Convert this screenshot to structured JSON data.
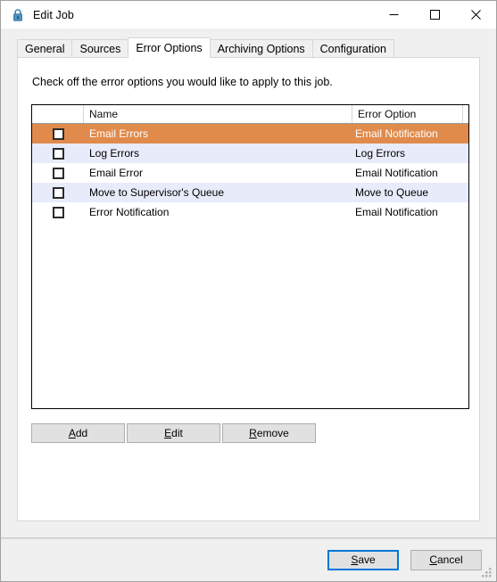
{
  "window": {
    "title": "Edit Job",
    "icon": "padlock-icon",
    "caption_buttons": [
      {
        "name": "minimize",
        "glyph": "—"
      },
      {
        "name": "maximize",
        "glyph": "□"
      },
      {
        "name": "close",
        "glyph": "✕"
      }
    ]
  },
  "tabs": [
    {
      "label": "General",
      "active": false
    },
    {
      "label": "Sources",
      "active": false
    },
    {
      "label": "Error Options",
      "active": true
    },
    {
      "label": "Archiving Options",
      "active": false
    },
    {
      "label": "Configuration",
      "active": false
    }
  ],
  "panel": {
    "instruction": "Check off the error options you would like to apply to this job."
  },
  "list": {
    "columns": [
      {
        "key": "check",
        "label": ""
      },
      {
        "key": "name",
        "label": "Name"
      },
      {
        "key": "option",
        "label": "Error Option"
      }
    ],
    "rows": [
      {
        "checked": false,
        "name": "Email Errors",
        "option": "Email Notification",
        "selected": true
      },
      {
        "checked": false,
        "name": "Log Errors",
        "option": "Log Errors",
        "selected": false
      },
      {
        "checked": false,
        "name": "Email Error",
        "option": "Email Notification",
        "selected": false
      },
      {
        "checked": false,
        "name": "Move to Supervisor's Queue",
        "option": "Move to Queue",
        "selected": false
      },
      {
        "checked": false,
        "name": "Error Notification",
        "option": "Email Notification",
        "selected": false
      }
    ]
  },
  "actions": {
    "add": {
      "accel": "A",
      "rest": "dd"
    },
    "edit": {
      "pre": "",
      "accel": "E",
      "rest": "dit"
    },
    "remove": {
      "accel": "R",
      "rest": "emove"
    }
  },
  "footer": {
    "save": {
      "accel": "S",
      "rest": "ave"
    },
    "cancel": {
      "pre": "",
      "accel": "C",
      "rest": "ancel"
    },
    "grip": "resize-grip"
  },
  "colors": {
    "selection": "#e08b4c",
    "alt_row": "#e8ebfa",
    "accent": "#0078d7",
    "window_bg": "#f0f0f0"
  }
}
